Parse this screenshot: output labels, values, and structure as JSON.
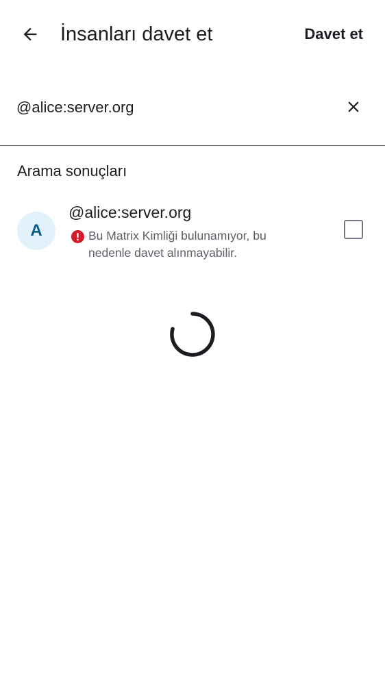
{
  "header": {
    "back_icon": "arrow-left-icon",
    "title": "İnsanları davet et",
    "invite_label": "Davet et"
  },
  "search": {
    "value": "@alice:server.org",
    "clear_icon": "close-icon"
  },
  "results": {
    "section_title": "Arama sonuçları",
    "items": [
      {
        "avatar_initial": "A",
        "name": "@alice:server.org",
        "warning_icon": "error-icon",
        "warning": "Bu Matrix Kimliği bulunamıyor, bu nedenle davet alınmayabilir.",
        "checked": false
      }
    ]
  },
  "loading": {
    "icon": "loading-spinner-icon"
  },
  "colors": {
    "text_primary": "#1b1d22",
    "text_secondary": "#5c6068",
    "error": "#d51928",
    "avatar_bg": "#e1f2fa",
    "avatar_fg": "#0a5a8c"
  }
}
